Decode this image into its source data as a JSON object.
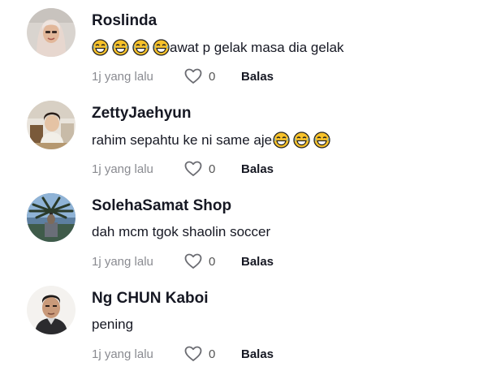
{
  "comments": [
    {
      "username": "Roslinda",
      "text_prefix_emojis": 4,
      "text": "awat p gelak masa dia gelak",
      "time": "1j yang lalu",
      "likes": "0",
      "reply_label": "Balas",
      "avatar_icon": "avatar-woman-hijab"
    },
    {
      "username": "ZettyJaehyun",
      "text": "rahim sepahtu ke ni same aje",
      "text_suffix_emojis": 3,
      "time": "1j yang lalu",
      "likes": "0",
      "reply_label": "Balas",
      "avatar_icon": "avatar-person-indoor"
    },
    {
      "username": "SolehaSamat Shop",
      "text": "dah mcm tgok shaolin soccer",
      "time": "1j yang lalu",
      "likes": "0",
      "reply_label": "Balas",
      "avatar_icon": "avatar-palm-tree"
    },
    {
      "username": "Ng CHUN Kaboi",
      "text": "pening",
      "time": "1j yang lalu",
      "likes": "0",
      "reply_label": "Balas",
      "avatar_icon": "avatar-man"
    }
  ],
  "colors": {
    "text": "#161823",
    "meta": "#8a8b91",
    "emoji_face": "#f7c22b"
  },
  "icons": {
    "emoji": "face-with-tears-of-joy-icon",
    "like": "heart-outline-icon"
  }
}
